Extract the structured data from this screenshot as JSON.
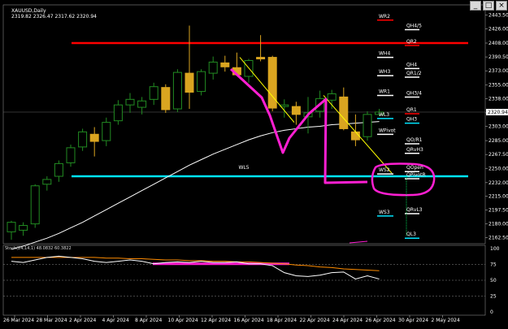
{
  "window": {
    "min_label": "_",
    "max_label": "□",
    "close_label": "×"
  },
  "symbol": {
    "title": "XAUUSD,Daily",
    "ohlc": "2319.82 2326.47 2317.62 2320.94"
  },
  "oscillator": {
    "label": "Stoch(24,14,1) 48.0832 60.3822"
  },
  "colors": {
    "background": "#000000",
    "bull": "#228b22",
    "bear": "#daa520",
    "ma": "#ffffff",
    "resistance": "#ff0000",
    "support": "#00e5ff",
    "annotation": "#ff1fd2",
    "trend": "#ffff00",
    "stoch_main": "#ffffff",
    "stoch_signal": "#ff8c00"
  },
  "chart_data": {
    "type": "candlestick",
    "x_tick_labels": [
      "26 Mar 2024",
      "28 Mar 2024",
      "2 Apr 2024",
      "4 Apr 2024",
      "8 Apr 2024",
      "10 Apr 2024",
      "12 Apr 2024",
      "16 Apr 2024",
      "18 Apr 2024",
      "22 Apr 2024",
      "24 Apr 2024",
      "26 Apr 2024",
      "30 Apr 2024",
      "2 May 2024"
    ],
    "y_axis_ticks": [
      2443.5,
      2426.0,
      2408.0,
      2390.5,
      2373.0,
      2355.0,
      2338.0,
      2320.0,
      2303.0,
      2285.0,
      2267.5,
      2250.0,
      2232.0,
      2215.0,
      2197.5,
      2180.0,
      2162.5
    ],
    "y_range": [
      2155,
      2450
    ],
    "current_price": "2320.94",
    "candles": [
      {
        "o": 2170,
        "h": 2184,
        "l": 2160,
        "c": 2182
      },
      {
        "o": 2172,
        "h": 2182,
        "l": 2165,
        "c": 2178
      },
      {
        "o": 2180,
        "h": 2230,
        "l": 2175,
        "c": 2228
      },
      {
        "o": 2230,
        "h": 2240,
        "l": 2222,
        "c": 2236
      },
      {
        "o": 2240,
        "h": 2260,
        "l": 2233,
        "c": 2256
      },
      {
        "o": 2257,
        "h": 2280,
        "l": 2252,
        "c": 2276
      },
      {
        "o": 2277,
        "h": 2300,
        "l": 2272,
        "c": 2296
      },
      {
        "o": 2293,
        "h": 2302,
        "l": 2265,
        "c": 2284
      },
      {
        "o": 2285,
        "h": 2314,
        "l": 2278,
        "c": 2308
      },
      {
        "o": 2310,
        "h": 2336,
        "l": 2305,
        "c": 2330
      },
      {
        "o": 2330,
        "h": 2345,
        "l": 2320,
        "c": 2337
      },
      {
        "o": 2327,
        "h": 2340,
        "l": 2318,
        "c": 2335
      },
      {
        "o": 2337,
        "h": 2358,
        "l": 2330,
        "c": 2353
      },
      {
        "o": 2352,
        "h": 2356,
        "l": 2320,
        "c": 2324
      },
      {
        "o": 2325,
        "h": 2375,
        "l": 2321,
        "c": 2371
      },
      {
        "o": 2370,
        "h": 2430,
        "l": 2325,
        "c": 2346
      },
      {
        "o": 2347,
        "h": 2375,
        "l": 2342,
        "c": 2372
      },
      {
        "o": 2370,
        "h": 2391,
        "l": 2362,
        "c": 2384
      },
      {
        "o": 2383,
        "h": 2392,
        "l": 2372,
        "c": 2378
      },
      {
        "o": 2377,
        "h": 2396,
        "l": 2371,
        "c": 2368
      },
      {
        "o": 2366,
        "h": 2388,
        "l": 2358,
        "c": 2386
      },
      {
        "o": 2390,
        "h": 2418,
        "l": 2385,
        "c": 2388
      },
      {
        "o": 2390,
        "h": 2392,
        "l": 2322,
        "c": 2326
      },
      {
        "o": 2328,
        "h": 2337,
        "l": 2314,
        "c": 2330
      },
      {
        "o": 2328,
        "h": 2334,
        "l": 2305,
        "c": 2318
      },
      {
        "o": 2315,
        "h": 2340,
        "l": 2294,
        "c": 2320
      },
      {
        "o": 2322,
        "h": 2348,
        "l": 2314,
        "c": 2338
      },
      {
        "o": 2336,
        "h": 2349,
        "l": 2325,
        "c": 2344
      },
      {
        "o": 2340,
        "h": 2352,
        "l": 2298,
        "c": 2300
      },
      {
        "o": 2296,
        "h": 2318,
        "l": 2278,
        "c": 2286
      },
      {
        "o": 2290,
        "h": 2322,
        "l": 2285,
        "c": 2318
      },
      {
        "o": 2318,
        "h": 2325,
        "l": 2316,
        "c": 2321
      }
    ],
    "moving_average": [
      2148,
      2152,
      2157,
      2162,
      2168,
      2175,
      2182,
      2190,
      2198,
      2206,
      2214,
      2222,
      2230,
      2238,
      2246,
      2254,
      2261,
      2268,
      2274,
      2280,
      2286,
      2291,
      2295,
      2298,
      2300,
      2302,
      2303,
      2305,
      2306,
      2307,
      2308,
      2309
    ],
    "levels_lines": [
      {
        "name": "QR2",
        "price": 2408,
        "color": "#ff0000"
      },
      {
        "name": "WL5",
        "price": 2240,
        "color": "#00e5ff"
      }
    ],
    "stochastic": {
      "y_ticks": [
        100,
        75,
        50,
        25,
        0
      ],
      "main": [
        80,
        78,
        82,
        86,
        88,
        86,
        84,
        80,
        78,
        80,
        82,
        80,
        76,
        78,
        79,
        78,
        80,
        78,
        78,
        79,
        76,
        76,
        73,
        62,
        57,
        56,
        58,
        62,
        63,
        52,
        57,
        52
      ],
      "signal": [
        86,
        86,
        86,
        86,
        86,
        86,
        86,
        86,
        85,
        85,
        84,
        84,
        83,
        82,
        82,
        81,
        81,
        80,
        80,
        79,
        79,
        78,
        77,
        76,
        74,
        73,
        71,
        70,
        68,
        67,
        66,
        65
      ]
    }
  },
  "pivot_labels": {
    "right": [
      "QH4/5",
      "QR2",
      "QH4",
      "QR1/2",
      "QH3/4",
      "QR1",
      "QH3",
      "QO/R1",
      "QRvH3",
      "QOpen",
      "QPivotR",
      "QRvL3",
      "QL3"
    ],
    "left": [
      "WR2",
      "WH4",
      "WH3",
      "WR1",
      "WL3",
      "WPivot",
      "WS2",
      "WS3"
    ]
  },
  "annotations": {
    "wl5_label": "WL5"
  }
}
